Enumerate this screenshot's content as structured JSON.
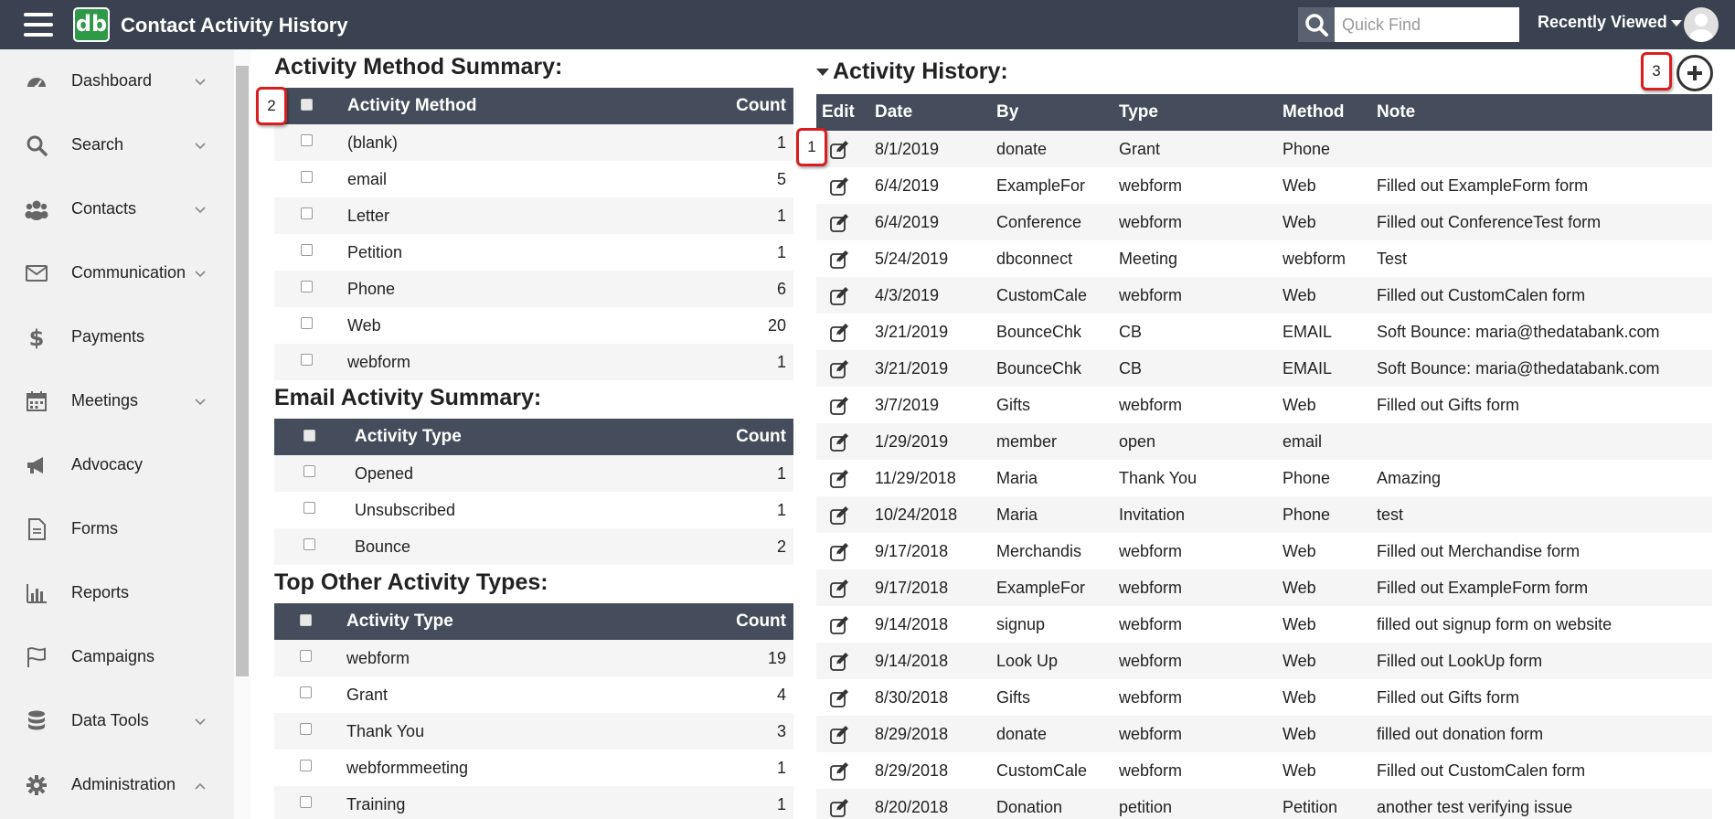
{
  "app": {
    "logo_text": "db",
    "title": "Contact Activity History"
  },
  "quick_find": {
    "placeholder": "Quick Find"
  },
  "recently_viewed": {
    "label": "Recently Viewed"
  },
  "sidebar": {
    "items": [
      {
        "label": "Dashboard",
        "icon": "dashboard-icon",
        "has_chevron": true
      },
      {
        "label": "Search",
        "icon": "search-icon",
        "has_chevron": true
      },
      {
        "label": "Contacts",
        "icon": "contacts-icon",
        "has_chevron": true
      },
      {
        "label": "Communication",
        "icon": "envelope-icon",
        "has_chevron": true
      },
      {
        "label": "Payments",
        "icon": "dollar-icon",
        "has_chevron": false
      },
      {
        "label": "Meetings",
        "icon": "calendar-icon",
        "has_chevron": true
      },
      {
        "label": "Advocacy",
        "icon": "megaphone-icon",
        "has_chevron": false
      },
      {
        "label": "Forms",
        "icon": "document-icon",
        "has_chevron": false
      },
      {
        "label": "Reports",
        "icon": "bar-chart-icon",
        "has_chevron": false
      },
      {
        "label": "Campaigns",
        "icon": "flag-icon",
        "has_chevron": false
      },
      {
        "label": "Data Tools",
        "icon": "database-icon",
        "has_chevron": true
      },
      {
        "label": "Administration",
        "icon": "gear-icon",
        "has_chevron": true,
        "expanded": true
      }
    ]
  },
  "activity_method_summary": {
    "title": "Activity Method Summary:",
    "col_name": "Activity Method",
    "col_count": "Count",
    "rows": [
      {
        "name": "(blank)",
        "count": "1"
      },
      {
        "name": "email",
        "count": "5"
      },
      {
        "name": "Letter",
        "count": "1"
      },
      {
        "name": "Petition",
        "count": "1"
      },
      {
        "name": "Phone",
        "count": "6"
      },
      {
        "name": "Web",
        "count": "20"
      },
      {
        "name": "webform",
        "count": "1"
      }
    ]
  },
  "email_activity_summary": {
    "title": "Email Activity Summary:",
    "col_name": "Activity Type",
    "col_count": "Count",
    "rows": [
      {
        "name": "Opened",
        "count": "1"
      },
      {
        "name": "Unsubscribed",
        "count": "1"
      },
      {
        "name": "Bounce",
        "count": "2"
      }
    ]
  },
  "top_other_activity_types": {
    "title": "Top Other Activity Types:",
    "col_name": "Activity Type",
    "col_count": "Count",
    "rows": [
      {
        "name": "webform",
        "count": "19"
      },
      {
        "name": "Grant",
        "count": "4"
      },
      {
        "name": "Thank You",
        "count": "3"
      },
      {
        "name": "webformmeeting",
        "count": "1"
      },
      {
        "name": "Training",
        "count": "1"
      }
    ]
  },
  "activity_history": {
    "title": "Activity History:",
    "columns": {
      "edit": "Edit",
      "date": "Date",
      "by": "By",
      "type": "Type",
      "method": "Method",
      "note": "Note"
    },
    "rows": [
      {
        "date": "8/1/2019",
        "by": "donate",
        "type": "Grant",
        "method": "Phone",
        "note": ""
      },
      {
        "date": "6/4/2019",
        "by": "ExampleFor",
        "type": "webform",
        "method": "Web",
        "note": "Filled out ExampleForm form"
      },
      {
        "date": "6/4/2019",
        "by": "Conference",
        "type": "webform",
        "method": "Web",
        "note": "Filled out ConferenceTest form"
      },
      {
        "date": "5/24/2019",
        "by": "dbconnect",
        "type": "Meeting",
        "method": "webform",
        "note": "Test"
      },
      {
        "date": "4/3/2019",
        "by": "CustomCale",
        "type": "webform",
        "method": "Web",
        "note": "Filled out CustomCalen form"
      },
      {
        "date": "3/21/2019",
        "by": "BounceChk",
        "type": "CB",
        "method": "EMAIL",
        "note": "Soft Bounce: maria@thedatabank.com"
      },
      {
        "date": "3/21/2019",
        "by": "BounceChk",
        "type": "CB",
        "method": "EMAIL",
        "note": "Soft Bounce: maria@thedatabank.com"
      },
      {
        "date": "3/7/2019",
        "by": "Gifts",
        "type": "webform",
        "method": "Web",
        "note": "Filled out Gifts form"
      },
      {
        "date": "1/29/2019",
        "by": "member",
        "type": "open",
        "method": "email",
        "note": ""
      },
      {
        "date": "11/29/2018",
        "by": "Maria",
        "type": "Thank You",
        "method": "Phone",
        "note": "Amazing"
      },
      {
        "date": "10/24/2018",
        "by": "Maria",
        "type": "Invitation",
        "method": "Phone",
        "note": "test"
      },
      {
        "date": "9/17/2018",
        "by": "Merchandis",
        "type": "webform",
        "method": "Web",
        "note": "Filled out Merchandise form"
      },
      {
        "date": "9/17/2018",
        "by": "ExampleFor",
        "type": "webform",
        "method": "Web",
        "note": "Filled out ExampleForm form"
      },
      {
        "date": "9/14/2018",
        "by": "signup",
        "type": "webform",
        "method": "Web",
        "note": "filled out signup form on website"
      },
      {
        "date": "9/14/2018",
        "by": "Look Up",
        "type": "webform",
        "method": "Web",
        "note": "Filled out LookUp form"
      },
      {
        "date": "8/30/2018",
        "by": "Gifts",
        "type": "webform",
        "method": "Web",
        "note": "Filled out Gifts form"
      },
      {
        "date": "8/29/2018",
        "by": "donate",
        "type": "webform",
        "method": "Web",
        "note": "filled out donation form"
      },
      {
        "date": "8/29/2018",
        "by": "CustomCale",
        "type": "webform",
        "method": "Web",
        "note": "Filled out CustomCalen form"
      },
      {
        "date": "8/20/2018",
        "by": "Donation",
        "type": "petition",
        "method": "Petition",
        "note": "another test verifying issue"
      }
    ]
  },
  "callouts": {
    "one": "1",
    "two": "2",
    "three": "3"
  },
  "colors": {
    "topbar": "#3a4150",
    "table_header": "#454c5b",
    "logo_green": "#2e9a47",
    "callout_red": "#d81e1e",
    "sidebar_bg": "#f1f1f1"
  }
}
